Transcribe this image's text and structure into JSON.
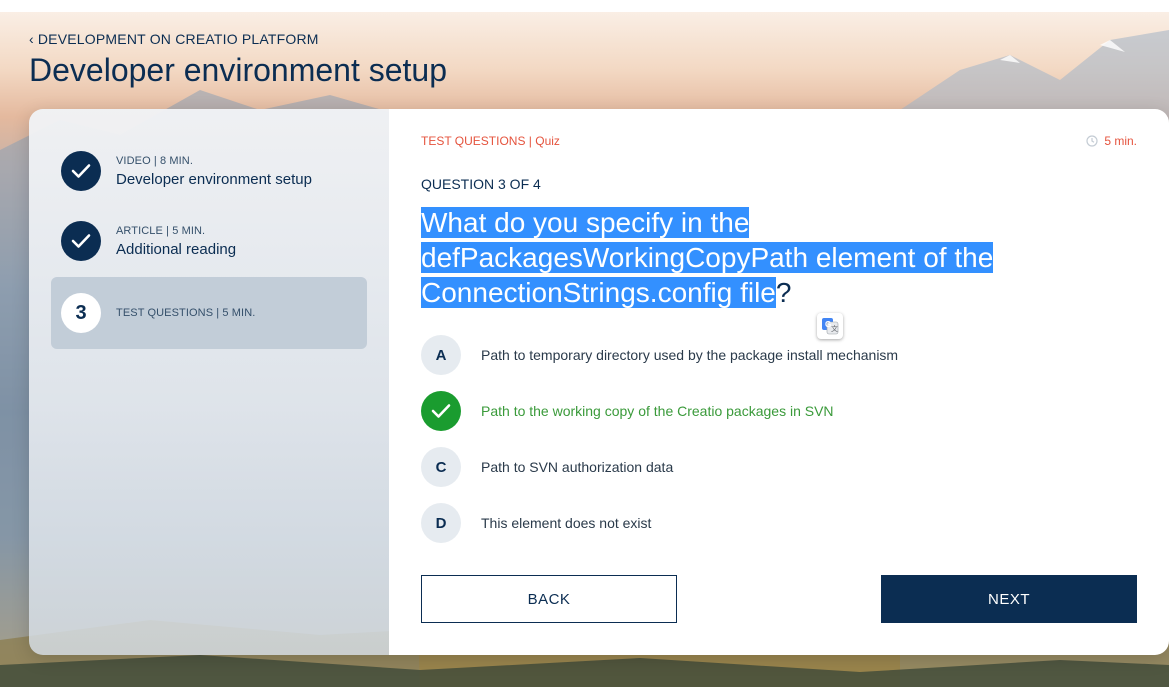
{
  "breadcrumb": {
    "chevron": "‹",
    "label": "DEVELOPMENT ON CREATIO PLATFORM"
  },
  "page": {
    "title": "Developer environment setup"
  },
  "steps": [
    {
      "kind": "VIDEO | 8 MIN.",
      "name": "Developer environment setup",
      "status": "done",
      "icon": "check-icon"
    },
    {
      "kind": "ARTICLE | 5 MIN.",
      "name": "Additional reading",
      "status": "done",
      "icon": "check-icon"
    },
    {
      "kind": "TEST QUESTIONS | 5 MIN.",
      "name": "",
      "status": "active",
      "number": "3"
    }
  ],
  "quiz": {
    "tag": "TEST QUESTIONS | Quiz",
    "timer": "5 min.",
    "counter": "QUESTION 3 OF 4",
    "question_highlighted": "What do you specify in the defPackagesWorkingCopyPath element of the ConnectionStrings.config file",
    "question_rest": "?"
  },
  "options": [
    {
      "letter": "A",
      "text": "Path to temporary directory used by the package install mechanism",
      "correct": false
    },
    {
      "letter": "",
      "text": "Path to the working copy of the Creatio packages in SVN",
      "correct": true
    },
    {
      "letter": "C",
      "text": "Path to SVN authorization data",
      "correct": false
    },
    {
      "letter": "D",
      "text": "This element does not exist",
      "correct": false
    }
  ],
  "buttons": {
    "back": "BACK",
    "next": "NEXT"
  },
  "colors": {
    "navy": "#0b2d52",
    "accent": "#e5533d",
    "correct": "#1a9c2f",
    "selection": "#3390ff"
  }
}
